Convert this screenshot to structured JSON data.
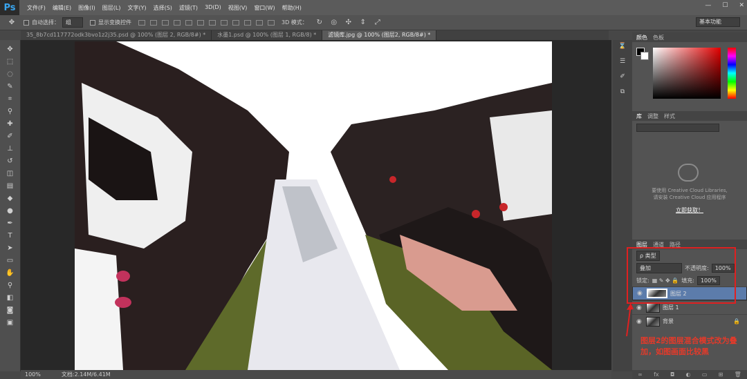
{
  "app": {
    "logo": "Ps"
  },
  "menu": [
    "文件(F)",
    "编辑(E)",
    "图像(I)",
    "图层(L)",
    "文字(Y)",
    "选择(S)",
    "滤镜(T)",
    "3D(D)",
    "视图(V)",
    "窗口(W)",
    "帮助(H)"
  ],
  "window_buttons": [
    "—",
    "☐",
    "✕"
  ],
  "options": {
    "auto_select_label": "自动选择：",
    "auto_select_value": "组",
    "show_transform_label": "显示变换控件",
    "mode_3d_label": "3D 模式：",
    "workspace": "基本功能"
  },
  "tabs": [
    {
      "label": "35_8b7cd117772odk3bvo1z2j35.psd @ 100% (图层 2, RGB/8#) *",
      "active": false
    },
    {
      "label": "水墨1.psd @ 100% (图层 1, RGB/8) *",
      "active": false
    },
    {
      "label": "滤镜库.jpg @ 100% (图层2, RGB/8#) *",
      "active": true
    }
  ],
  "status": {
    "zoom": "100%",
    "doc": "文档:2.14M/6.41M"
  },
  "color_panel": {
    "tabs": [
      "颜色",
      "色板"
    ],
    "fg": "#000000",
    "bg": "#ffffff",
    "hue": "#e20000"
  },
  "libraries_panel": {
    "tabs": [
      "库",
      "调整",
      "样式"
    ],
    "message_line1": "要使用 Creative Cloud Libraries,",
    "message_line2": "请安装 Creative Cloud 应用程序",
    "link": "立即获取！"
  },
  "layers_panel": {
    "tabs": [
      "图层",
      "通道",
      "路径"
    ],
    "filter_kind": "ρ 类型",
    "blend_mode": "叠加",
    "opacity_label": "不透明度:",
    "opacity": "100%",
    "lock_label": "锁定:",
    "fill_label": "填充:",
    "fill": "100%",
    "layers": [
      {
        "name": "图层 2",
        "selected": true
      },
      {
        "name": "图层 1",
        "selected": false
      },
      {
        "name": "背景",
        "selected": false
      }
    ]
  },
  "annotation": {
    "text": "图层2的图层混合模式改为叠加，如图画面比较黑",
    "color": "#e43a2a"
  }
}
